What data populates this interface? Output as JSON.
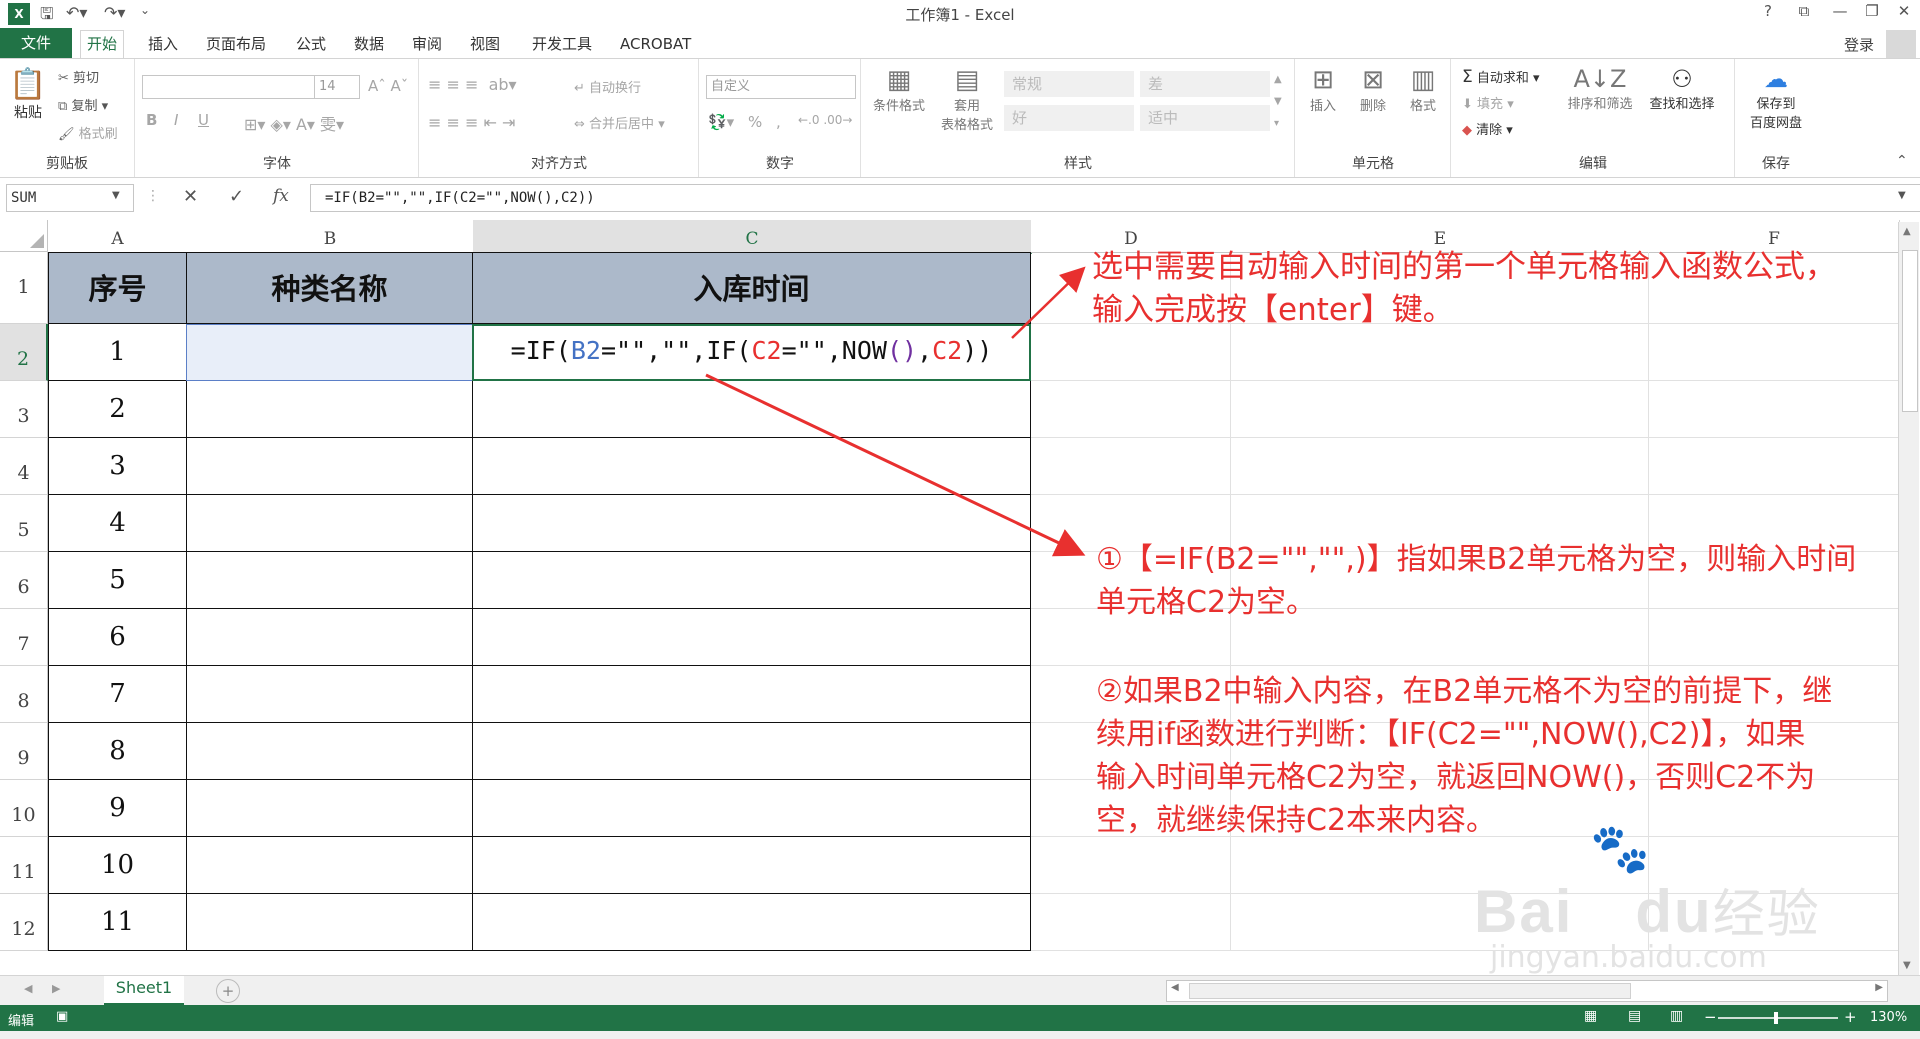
{
  "window": {
    "title": "工作簿1 - Excel",
    "help": "?",
    "restore_ribbon": "⧉",
    "minimize": "—",
    "maximize": "❐",
    "close": "✕"
  },
  "tabs": [
    "文件",
    "开始",
    "插入",
    "页面布局",
    "公式",
    "数据",
    "审阅",
    "视图",
    "开发工具",
    "ACROBAT"
  ],
  "account": {
    "login": "登录"
  },
  "ribbon": {
    "clipboard": {
      "label": "剪贴板",
      "paste": "粘贴",
      "cut": "剪切",
      "copy": "复制",
      "format_painter": "格式刷"
    },
    "font": {
      "label": "字体",
      "size": "14",
      "bold": "B",
      "italic": "I",
      "underline": "U"
    },
    "alignment": {
      "label": "对齐方式",
      "wrap": "自动换行",
      "merge": "合并后居中"
    },
    "number": {
      "label": "数字",
      "format": "自定义",
      "percent": "%",
      "comma": ","
    },
    "styles": {
      "label": "样式",
      "conditional": "条件格式",
      "table_line1": "套用",
      "table_line2": "表格格式",
      "normal": "常规",
      "bad": "差",
      "good": "好",
      "neutral": "适中"
    },
    "cells": {
      "label": "单元格",
      "insert": "插入",
      "delete": "删除",
      "format": "格式"
    },
    "editing": {
      "label": "编辑",
      "autosum": "自动求和",
      "fill": "填充",
      "clear": "清除",
      "sort": "排序和筛选",
      "find": "查找和选择"
    },
    "save": {
      "label": "保存",
      "baidu_line1": "保存到",
      "baidu_line2": "百度网盘"
    }
  },
  "formula_bar": {
    "name_box": "SUM",
    "formula": "=IF(B2=\"\",\"\",IF(C2=\"\",NOW(),C2))"
  },
  "columns": [
    "A",
    "B",
    "C",
    "D",
    "E",
    "F"
  ],
  "rows": [
    "1",
    "2",
    "3",
    "4",
    "5",
    "6",
    "7",
    "8",
    "9",
    "10",
    "11",
    "12"
  ],
  "table": {
    "headers": [
      "序号",
      "种类名称",
      "入库时间"
    ],
    "serials": [
      "1",
      "2",
      "3",
      "4",
      "5",
      "6",
      "7",
      "8",
      "9",
      "10",
      "11"
    ]
  },
  "cell_formula": {
    "p1": "=IF(",
    "p2": "B2",
    "p3": "=\"\",\"\",IF(",
    "p4": "C2",
    "p5": "=\"\",NOW",
    "p6": "()",
    "p7": ",",
    "p8": "C2",
    "p9": "))"
  },
  "annotations": {
    "top_line1": "选中需要自动输入时间的第一个单元格输入函数公式，",
    "top_line2": "输入完成按【enter】键。",
    "one_line1": "①【=IF(B2=\"\",\"\",)】指如果B2单元格为空，则输入时间",
    "one_line2": "单元格C2为空。",
    "two_line1": "②如果B2中输入内容，在B2单元格不为空的前提下，继",
    "two_line2": "续用if函数进行判断：【IF(C2=\"\",NOW(),C2)】，如果",
    "two_line3": "输入时间单元格C2为空，就返回NOW()，否则C2不为",
    "two_line4": "空，就继续保持C2本来内容。",
    "watermark_main": "Bai",
    "watermark_du": "du",
    "watermark_cn": "经验",
    "watermark_url": "jingyan.baidu.com"
  },
  "sheet_tabs": {
    "active": "Sheet1",
    "add": "+"
  },
  "status": {
    "mode": "编辑",
    "zoom": "130%"
  },
  "colors": {
    "excel_green": "#217346",
    "header_fill": "#acb9ca",
    "annotation_red": "#e8302f",
    "ref_blue": "#4472c4",
    "ref_red": "#e8302f",
    "ref_purple": "#7030a0"
  }
}
